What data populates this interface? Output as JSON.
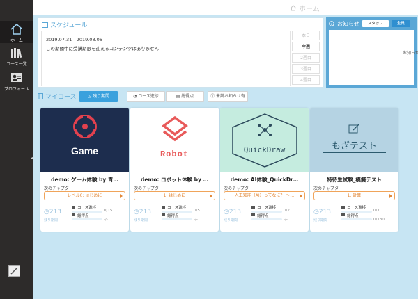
{
  "topbar": {
    "home_label": "ホーム"
  },
  "sidebar": {
    "items": [
      {
        "label": "ホーム",
        "icon": "home-icon"
      },
      {
        "label": "コース一覧",
        "icon": "books-icon"
      },
      {
        "label": "プロフィール",
        "icon": "profile-icon"
      }
    ],
    "bottom_icon": "pencil-icon"
  },
  "schedule": {
    "title": "スケジュール",
    "range": "2019.07.31 - 2019.08.06",
    "message": "この期間中に受講期限を迎えるコンテンツはありません",
    "periods": [
      "本日",
      "今週",
      "2週目",
      "3週目",
      "4週目"
    ],
    "active_period": "今週"
  },
  "news": {
    "title": "お知らせ",
    "tabs": [
      "スタッフ",
      "全員"
    ],
    "active_tab": "全員",
    "body_text": "お知らせ"
  },
  "mycourse": {
    "title": "マイコース",
    "filters": [
      "残り期間",
      "コース進捗",
      "総得点",
      "未読お知らせ有"
    ],
    "active_filter": "残り期間",
    "next_chapter_label": "次のチャプター",
    "days_label": "残り期間",
    "progress_label": "コース進捗",
    "score_label": "総得点"
  },
  "courses": [
    {
      "title": "demo: ゲーム体験 by 青…",
      "thumb_text": "Game",
      "thumb_bg": "#1d2d4e",
      "accent": "#e2414e",
      "next_chapter": "レベル0: はじめに",
      "days": "213",
      "progress": "0/15",
      "progress_fraction": 0.0,
      "score": "-/-"
    },
    {
      "title": "demo: ロボット体験 by …",
      "thumb_text": "Robot",
      "thumb_bg": "#ffffff",
      "accent": "#e85a5a",
      "next_chapter": "1. はじめに",
      "days": "213",
      "progress": "0/5",
      "progress_fraction": 0.0,
      "score": "-/-"
    },
    {
      "title": "demo: AI体験_QuickDr…",
      "thumb_text": "QuickDraw",
      "thumb_bg": "#c5ecdf",
      "accent": "#2c4a5c",
      "next_chapter": "人工知能（AI）ってなに？ ～…",
      "days": "213",
      "progress": "0/2",
      "progress_fraction": 0.0,
      "score": "-/-"
    },
    {
      "title": "特待生試験_模擬テスト",
      "thumb_text": "もぎテスト",
      "thumb_bg": "#b5d3e3",
      "accent": "#2c5a6e",
      "next_chapter": "1. 計算",
      "days": "213",
      "progress": "0/7",
      "progress_fraction": 0.0,
      "score": "0/130"
    }
  ]
}
